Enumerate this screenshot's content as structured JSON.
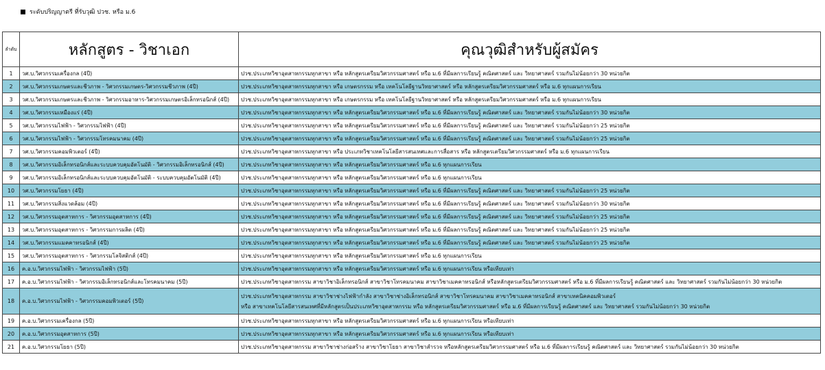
{
  "heading": "ระดับปริญญาตรี ที่รับวุฒิ ปวช. หรือ ม.6",
  "table": {
    "headers": [
      "ลำดับ",
      "หลักสูตร - วิชาเอก",
      "คุณวุฒิสำหรับผู้สมัคร"
    ],
    "rows": [
      {
        "no": "1",
        "program": "วศ.บ.วิศวกรรมเครื่องกล (4ปี)",
        "qual": "ปวช.ประเภทวิชาอุตสาหกรรมทุกสาขา หรือ หลักสูตรเตรียมวิศวกรรมศาสตร์ หรือ ม.6 ที่มีผลการเรียนรู้ คณิตศาสตร์ และ วิทยาศาสตร์ รวมกันไม่น้อยกว่า 30 หน่วยกิต"
      },
      {
        "no": "2",
        "program": "วศ.บ.วิศวกรรมเกษตรและชีวภาพ - วิศวกรรมเกษตร-วิศวกรรมชีวภาพ (4ปี)",
        "qual": "ปวช.ประเภทวิชาอุตสาหกรรมทุกสาขา หรือ เกษตรกรรม หรือ เทคโนโลยีฐานวิทยาศาสตร์ หรือ หลักสูตรเตรียมวิศวกรรมศาสตร์ หรือ ม.6 ทุกแผนการเรียน"
      },
      {
        "no": "3",
        "program": "วศ.บ.วิศวกรรมเกษตรและชีวภาพ - วิศวกรรมอาหาร-วิศวกรรมเกษตรอิเล็กทรอนิกส์ (4ปี)",
        "qual": "ปวช.ประเภทวิชาอุตสาหกรรมทุกสาขา หรือ เกษตรกรรม หรือ เทคโนโลยีฐานวิทยาศาสตร์ หรือ หลักสูตรเตรียมวิศวกรรมศาสตร์ หรือ ม.6 ทุกแผนการเรียน"
      },
      {
        "no": "4",
        "program": "วศ.บ.วิศวกรรมเหมืองแร่ (4ปี)",
        "qual": "ปวช.ประเภทวิชาอุตสาหกรรมทุกสาขา หรือ หลักสูตรเตรียมวิศวกรรมศาสตร์ หรือ ม.6 ที่มีผลการเรียนรู้ คณิตศาสตร์ และ วิทยาศาสตร์ รวมกันไม่น้อยกว่า 30 หน่วยกิต"
      },
      {
        "no": "5",
        "program": "วศ.บ.วิศวกรรมไฟฟ้า - วิศวกรรมไฟฟ้า (4ปี)",
        "qual": "ปวช.ประเภทวิชาอุตสาหกรรมทุกสาขา หรือ หลักสูตรเตรียมวิศวกรรมศาสตร์ หรือ ม.6 ที่มีผลการเรียนรู้ คณิตศาสตร์ และ วิทยาศาสตร์ รวมกันไม่น้อยกว่า 25 หน่วยกิต"
      },
      {
        "no": "6",
        "program": "วศ.บ.วิศวกรรมไฟฟ้า - วิศวกรรมโทรคมนาคม (4ปี)",
        "qual": "ปวช.ประเภทวิชาอุตสาหกรรมทุกสาขา หรือ หลักสูตรเตรียมวิศวกรรมศาสตร์ หรือ ม.6 ที่มีผลการเรียนรู้ คณิตศาสตร์ และ วิทยาศาสตร์ รวมกันไม่น้อยกว่า 25 หน่วยกิต"
      },
      {
        "no": "7",
        "program": "วศ.บ.วิศวกรรมคอมพิวเตอร์ (4ปี)",
        "qual": "ปวช.ประเภทวิชาอุตสาหกรรมทุกสาขา หรือ ประเภทวิชาเทคโนโลยีสารสนเทศและการสื่อสาร หรือ หลักสูตรเตรียมวิศวกรรมศาสตร์ หรือ ม.6 ทุกแผนการเรียน"
      },
      {
        "no": "8",
        "program": "วศ.บ.วิศวกรรมอิเล็กทรอนิกส์และระบบควบคุมอัตโนมัติ - วิศวกรรมอิเล็กทรอนิกส์ (4ปี)",
        "qual": "ปวช.ประเภทวิชาอุตสาหกรรมทุกสาขา หรือ หลักสูตรเตรียมวิศวกรรมศาสตร์ หรือ ม.6 ทุกแผนการเรียน"
      },
      {
        "no": "9",
        "program": "วศ.บ.วิศวกรรมอิเล็กทรอนิกส์และระบบควบคุมอัตโนมัติ - ระบบควบคุมอัตโนมัติ (4ปี)",
        "qual": "ปวช.ประเภทวิชาอุตสาหกรรมทุกสาขา หรือ หลักสูตรเตรียมวิศวกรรมศาสตร์ หรือ ม.6 ทุกแผนการเรียน"
      },
      {
        "no": "10",
        "program": "วศ.บ.วิศวกรรมโยธา (4ปี)",
        "qual": "ปวช.ประเภทวิชาอุตสาหกรรมทุกสาขา หรือ หลักสูตรเตรียมวิศวกรรมศาสตร์ หรือ ม.6 ที่มีผลการเรียนรู้ คณิตศาสตร์ และ วิทยาศาสตร์ รวมกันไม่น้อยกว่า 25 หน่วยกิต"
      },
      {
        "no": "11",
        "program": "วศ.บ.วิศวกรรมสิ่งแวดล้อม (4ปี)",
        "qual": "ปวช.ประเภทวิชาอุตสาหกรรมทุกสาขา หรือ หลักสูตรเตรียมวิศวกรรมศาสตร์ หรือ ม.6 ที่มีผลการเรียนรู้ คณิตศาสตร์ และ วิทยาศาสตร์ รวมกันไม่น้อยกว่า 30 หน่วยกิต"
      },
      {
        "no": "12",
        "program": "วศ.บ.วิศวกรรมอุตสาหการ - วิศวกรรมอุตสาหการ (4ปี)",
        "qual": "ปวช.ประเภทวิชาอุตสาหกรรมทุกสาขา หรือ หลักสูตรเตรียมวิศวกรรมศาสตร์ หรือ ม.6 ที่มีผลการเรียนรู้ คณิตศาสตร์ และ วิทยาศาสตร์ รวมกันไม่น้อยกว่า 25 หน่วยกิต"
      },
      {
        "no": "13",
        "program": "วศ.บ.วิศวกรรมอุตสาหการ - วิศวกรรมการผลิต (4ปี)",
        "qual": "ปวช.ประเภทวิชาอุตสาหกรรมทุกสาขา หรือ หลักสูตรเตรียมวิศวกรรมศาสตร์ หรือ ม.6 ที่มีผลการเรียนรู้ คณิตศาสตร์ และ วิทยาศาสตร์ รวมกันไม่น้อยกว่า 25 หน่วยกิต"
      },
      {
        "no": "14",
        "program": "วศ.บ.วิศวกรรมแมคคาทรอนิกส์ (4ปี)",
        "qual": "ปวช.ประเภทวิชาอุตสาหกรรมทุกสาขา หรือ หลักสูตรเตรียมวิศวกรรมศาสตร์ หรือ ม.6 ที่มีผลการเรียนรู้ คณิตศาสตร์ และ วิทยาศาสตร์ รวมกันไม่น้อยกว่า 25 หน่วยกิต"
      },
      {
        "no": "15",
        "program": "วศ.บ.วิศวกรรมอุตสาหการ - วิศวกรรมโลจิสติกส์ (4ปี)",
        "qual": "ปวช.ประเภทวิชาอุตสาหกรรมทุกสาขา หรือ หลักสูตรเตรียมวิศวกรรมศาสตร์ หรือ ม.6 ทุกแผนการเรียน"
      },
      {
        "no": "16",
        "program": "ค.อ.บ.วิศวกรรมไฟฟ้า - วิศวกรรมไฟฟ้า (5ปี)",
        "qual": "ปวช.ประเภทวิชาอุตสาหกรรมทุกสาขา หรือ หลักสูตรเตรียมวิศวกรรมศาสตร์ หรือ ม.6 ทุกแผนการเรียน หรือเทียบเท่า"
      },
      {
        "no": "17",
        "program": "ค.อ.บ.วิศวกรรมไฟฟ้า - วิศวกรรมอิเล็กทรอนิกส์และโทรคมนาคม (5ปี)",
        "qual": "ปวช.ประเภทวิชาอุตสาหกรรม สาขาวิชาอิเล็กทรอนิกส์ สาขาวิชาโทรคมนาคม สาขาวิชาเมคคาทรอนิกส์ หรือหลักสูตรเตรียมวิศวกรรมศาสตร์ หรือ ม.6 ที่มีผลการเรียนรู้ คณิตศาสตร์ และ วิทยาศาสตร์ รวมกันไม่น้อยกว่า 30 หน่วยกิต"
      },
      {
        "no": "18",
        "program": "ค.อ.บ.วิศวกรรมไฟฟ้า - วิศวกรรมคอมพิวเตอร์ (5ปี)",
        "qual": "ปวช.ประเภทวิชาอุตสาหกรรม สาขาวิชาช่างไฟฟ้ากำลัง สาขาวิชาช่างอิเล็กทรอนิกส์ สาขาวิชาโทรคมนาคม สาขาวิชาเมคคาทรอนิกส์ สาขาเทคนิคคอมพิวเตอร์",
        "qual2": "หรือ สาขาเทคโนโลยีสารสนเทศที่มีหลักสูตรเป็นประเภทวิชาอุตสาหกรรม หรือ หลักสูตรเตรียมวิศวกรรมศาสตร์ หรือ ม.6 ที่มีผลการเรียนรู้ คณิตศาสตร์ และ วิทยาศาสตร์ รวมกันไม่น้อยกว่า 30 หน่วยกิต"
      },
      {
        "no": "19",
        "program": "ค.อ.บ.วิศวกรรมเครื่องกล (5ปี)",
        "qual": "ปวช.ประเภทวิชาอุตสาหกรรมทุกสาขา หรือ หลักสูตรเตรียมวิศวกรรมศาสตร์ หรือ ม.6 ทุกแผนการเรียน หรือเทียบเท่า"
      },
      {
        "no": "20",
        "program": "ค.อ.บ.วิศวกรรมอุตสาหการ (5ปี)",
        "qual": "ปวช.ประเภทวิชาอุตสาหกรรมทุกสาขา หรือ หลักสูตรเตรียมวิศวกรรมศาสตร์ หรือ ม.6 ทุกแผนการเรียน หรือเทียบเท่า"
      },
      {
        "no": "21",
        "program": "ค.อ.บ.วิศวกรรมโยธา (5ปี)",
        "qual": "ปวช.ประเภทวิชาอุตสาหกรรม สาขาวิชาช่างก่อสร้าง สาขาวิชาโยธา สาขาวิชาสำรวจ หรือหลักสูตรเตรียมวิศวกรรมศาสตร์ หรือ ม.6 ที่มีผลการเรียนรู้ คณิตศาสตร์ และ วิทยาศาสตร์ รวมกันไม่น้อยกว่า 30 หน่วยกิต"
      }
    ]
  },
  "colors": {
    "row_highlight": "#92cddc",
    "border": "#444444"
  }
}
